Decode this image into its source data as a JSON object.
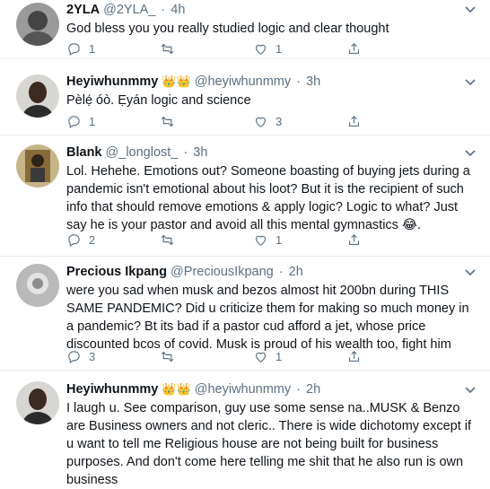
{
  "tweets": [
    {
      "name": "2YLA",
      "badge": "",
      "handle": "@2YLA_",
      "dot": "·",
      "time": "4h",
      "text": "God bless you you really studied logic and clear thought",
      "replies": "1",
      "retweets": "",
      "likes": "1"
    },
    {
      "name": "Heyiwhunmmy",
      "badge": "👑👑",
      "handle": "@heyiwhunmmy",
      "dot": "·",
      "time": "3h",
      "text": "Pèlẹ́ óò. Ẹyán logic and science",
      "replies": "1",
      "retweets": "",
      "likes": "3"
    },
    {
      "name": "Blank",
      "badge": "",
      "handle": "@_longlost_",
      "dot": "·",
      "time": "3h",
      "text": "Lol. Hehehe. Emotions out? Someone boasting of buying jets during a pandemic isn't emotional about his loot? But it is the recipient of such info that should remove emotions & apply logic? Logic to what? Just say he is your pastor and avoid all this mental gymnastics 😂.",
      "replies": "2",
      "retweets": "",
      "likes": "1"
    },
    {
      "name": "Precious Ikpang",
      "badge": "",
      "handle": "@PreciousIkpang",
      "dot": "·",
      "time": "2h",
      "text": "were you sad when musk and bezos almost hit 200bn during THIS SAME PANDEMIC? Did u criticize them for making so much money in a pandemic? Bt its bad if a pastor cud afford a jet, whose price discounted bcos of covid. Musk is proud of his wealth too, fight him",
      "replies": "3",
      "retweets": "",
      "likes": "1"
    },
    {
      "name": "Heyiwhunmmy",
      "badge": "👑👑",
      "handle": "@heyiwhunmmy",
      "dot": "·",
      "time": "2h",
      "text": "I laugh u. See comparison, guy use some sense na..MUSK & Benzo are Business owners and not cleric.. There is wide dichotomy except if u want to tell me Religious house are not being built for business purposes. And don't come here telling me shit that he also run is own business",
      "replies": "",
      "retweets": "",
      "likes": ""
    }
  ],
  "icons": {
    "reply": "reply-icon",
    "retweet": "retweet-icon",
    "like": "like-icon",
    "share": "share-icon",
    "more": "more-caret-icon"
  },
  "colors": {
    "secondary_text": "#5b7083",
    "divider": "#e6ecf0",
    "thread_line": "#ccd6dd"
  }
}
